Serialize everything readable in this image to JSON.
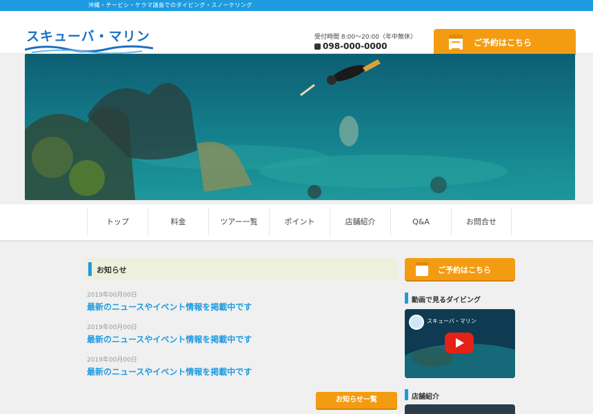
{
  "topbar": {
    "tagline": "沖縄・チービシ・ケラマ諸島でのダイビング・スノーケリング"
  },
  "header": {
    "logo_text": "スキューバ・マリン",
    "hours": "受付時間 8:00〜20:00（年中無休）",
    "phone": "098-000-0000",
    "web_button": "ご予約はこちら"
  },
  "hero": {
    "alt": "海中でダイバーが泳ぐ写真"
  },
  "nav": {
    "items": [
      {
        "label": "トップ"
      },
      {
        "label": "料金"
      },
      {
        "label": "ツアー一覧"
      },
      {
        "label": "ポイント"
      },
      {
        "label": "店舗紹介"
      },
      {
        "label": "Q&A"
      },
      {
        "label": "お問合せ"
      }
    ]
  },
  "main": {
    "heading": "お知らせ",
    "news": [
      {
        "date": "2019年00月00日",
        "title": "最新のニュースやイベント情報を掲載中です"
      },
      {
        "date": "2019年00月00日",
        "title": "最新のニュースやイベント情報を掲載中です"
      },
      {
        "date": "2019年00月00日",
        "title": "最新のニュースやイベント情報を掲載中です"
      }
    ],
    "list_button": "お知らせ一覧"
  },
  "side": {
    "web_button": "ご予約はこちら",
    "video_heading": "動画で見るダイビング",
    "video_title": "スキューバ・マリン",
    "shop_heading": "店舗紹介"
  },
  "colors": {
    "accent": "#1e9be0",
    "orange": "#f39c12",
    "heading_bg": "#edf0dc"
  }
}
